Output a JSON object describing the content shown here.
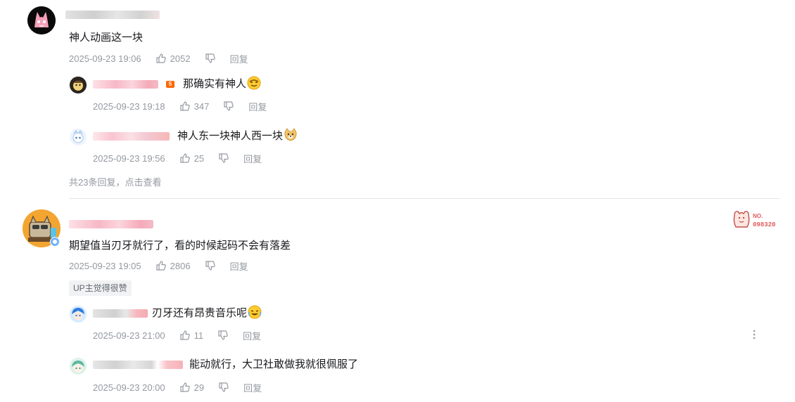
{
  "comments": [
    {
      "text": "神人动画这一块",
      "date": "2025-09-23 19:06",
      "likes": "2052",
      "reply_label": "回复",
      "replies": [
        {
          "text": "那确实有神人",
          "date": "2025-09-23 19:18",
          "likes": "347",
          "reply_label": "回复",
          "level": "5"
        },
        {
          "text": "神人东一块神人西一块",
          "date": "2025-09-23 19:56",
          "likes": "25",
          "reply_label": "回复"
        }
      ],
      "reply_count_text": "共23条回复，点击查看"
    },
    {
      "text": "期望值当刃牙就行了，看的时候起码不会有落差",
      "date": "2025-09-23 19:05",
      "likes": "2806",
      "reply_label": "回复",
      "tag": "UP主觉得很赞",
      "fan_badge": {
        "no_label": "NO.",
        "number": "098320"
      },
      "replies": [
        {
          "text": "刃牙还有昂贵音乐呢",
          "date": "2025-09-23 21:00",
          "likes": "11",
          "reply_label": "回复"
        },
        {
          "text": "能动就行，大卫社敢做我就很佩服了",
          "date": "2025-09-23 20:00",
          "likes": "29",
          "reply_label": "回复"
        }
      ]
    }
  ],
  "icons": {
    "like": "thumb-up-icon",
    "dislike": "thumb-down-icon",
    "more": "more-vertical-icon"
  },
  "colors": {
    "meta_text": "#9499a0",
    "level_badge": "#ff6600",
    "fan_badge": "#e05a5a"
  }
}
